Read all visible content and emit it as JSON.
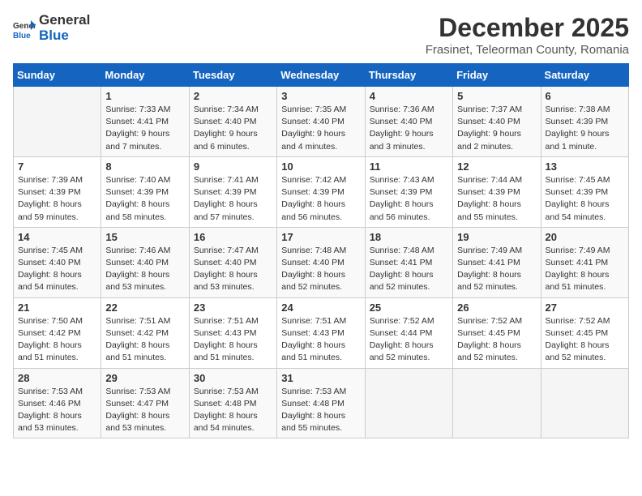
{
  "logo": {
    "text_general": "General",
    "text_blue": "Blue"
  },
  "title": {
    "month_year": "December 2025",
    "location": "Frasinet, Teleorman County, Romania"
  },
  "weekdays": [
    "Sunday",
    "Monday",
    "Tuesday",
    "Wednesday",
    "Thursday",
    "Friday",
    "Saturday"
  ],
  "weeks": [
    [
      {
        "day": "",
        "sunrise": "",
        "sunset": "",
        "daylight": ""
      },
      {
        "day": "1",
        "sunrise": "Sunrise: 7:33 AM",
        "sunset": "Sunset: 4:41 PM",
        "daylight": "Daylight: 9 hours and 7 minutes."
      },
      {
        "day": "2",
        "sunrise": "Sunrise: 7:34 AM",
        "sunset": "Sunset: 4:40 PM",
        "daylight": "Daylight: 9 hours and 6 minutes."
      },
      {
        "day": "3",
        "sunrise": "Sunrise: 7:35 AM",
        "sunset": "Sunset: 4:40 PM",
        "daylight": "Daylight: 9 hours and 4 minutes."
      },
      {
        "day": "4",
        "sunrise": "Sunrise: 7:36 AM",
        "sunset": "Sunset: 4:40 PM",
        "daylight": "Daylight: 9 hours and 3 minutes."
      },
      {
        "day": "5",
        "sunrise": "Sunrise: 7:37 AM",
        "sunset": "Sunset: 4:40 PM",
        "daylight": "Daylight: 9 hours and 2 minutes."
      },
      {
        "day": "6",
        "sunrise": "Sunrise: 7:38 AM",
        "sunset": "Sunset: 4:39 PM",
        "daylight": "Daylight: 9 hours and 1 minute."
      }
    ],
    [
      {
        "day": "7",
        "sunrise": "Sunrise: 7:39 AM",
        "sunset": "Sunset: 4:39 PM",
        "daylight": "Daylight: 8 hours and 59 minutes."
      },
      {
        "day": "8",
        "sunrise": "Sunrise: 7:40 AM",
        "sunset": "Sunset: 4:39 PM",
        "daylight": "Daylight: 8 hours and 58 minutes."
      },
      {
        "day": "9",
        "sunrise": "Sunrise: 7:41 AM",
        "sunset": "Sunset: 4:39 PM",
        "daylight": "Daylight: 8 hours and 57 minutes."
      },
      {
        "day": "10",
        "sunrise": "Sunrise: 7:42 AM",
        "sunset": "Sunset: 4:39 PM",
        "daylight": "Daylight: 8 hours and 56 minutes."
      },
      {
        "day": "11",
        "sunrise": "Sunrise: 7:43 AM",
        "sunset": "Sunset: 4:39 PM",
        "daylight": "Daylight: 8 hours and 56 minutes."
      },
      {
        "day": "12",
        "sunrise": "Sunrise: 7:44 AM",
        "sunset": "Sunset: 4:39 PM",
        "daylight": "Daylight: 8 hours and 55 minutes."
      },
      {
        "day": "13",
        "sunrise": "Sunrise: 7:45 AM",
        "sunset": "Sunset: 4:39 PM",
        "daylight": "Daylight: 8 hours and 54 minutes."
      }
    ],
    [
      {
        "day": "14",
        "sunrise": "Sunrise: 7:45 AM",
        "sunset": "Sunset: 4:40 PM",
        "daylight": "Daylight: 8 hours and 54 minutes."
      },
      {
        "day": "15",
        "sunrise": "Sunrise: 7:46 AM",
        "sunset": "Sunset: 4:40 PM",
        "daylight": "Daylight: 8 hours and 53 minutes."
      },
      {
        "day": "16",
        "sunrise": "Sunrise: 7:47 AM",
        "sunset": "Sunset: 4:40 PM",
        "daylight": "Daylight: 8 hours and 53 minutes."
      },
      {
        "day": "17",
        "sunrise": "Sunrise: 7:48 AM",
        "sunset": "Sunset: 4:40 PM",
        "daylight": "Daylight: 8 hours and 52 minutes."
      },
      {
        "day": "18",
        "sunrise": "Sunrise: 7:48 AM",
        "sunset": "Sunset: 4:41 PM",
        "daylight": "Daylight: 8 hours and 52 minutes."
      },
      {
        "day": "19",
        "sunrise": "Sunrise: 7:49 AM",
        "sunset": "Sunset: 4:41 PM",
        "daylight": "Daylight: 8 hours and 52 minutes."
      },
      {
        "day": "20",
        "sunrise": "Sunrise: 7:49 AM",
        "sunset": "Sunset: 4:41 PM",
        "daylight": "Daylight: 8 hours and 51 minutes."
      }
    ],
    [
      {
        "day": "21",
        "sunrise": "Sunrise: 7:50 AM",
        "sunset": "Sunset: 4:42 PM",
        "daylight": "Daylight: 8 hours and 51 minutes."
      },
      {
        "day": "22",
        "sunrise": "Sunrise: 7:51 AM",
        "sunset": "Sunset: 4:42 PM",
        "daylight": "Daylight: 8 hours and 51 minutes."
      },
      {
        "day": "23",
        "sunrise": "Sunrise: 7:51 AM",
        "sunset": "Sunset: 4:43 PM",
        "daylight": "Daylight: 8 hours and 51 minutes."
      },
      {
        "day": "24",
        "sunrise": "Sunrise: 7:51 AM",
        "sunset": "Sunset: 4:43 PM",
        "daylight": "Daylight: 8 hours and 51 minutes."
      },
      {
        "day": "25",
        "sunrise": "Sunrise: 7:52 AM",
        "sunset": "Sunset: 4:44 PM",
        "daylight": "Daylight: 8 hours and 52 minutes."
      },
      {
        "day": "26",
        "sunrise": "Sunrise: 7:52 AM",
        "sunset": "Sunset: 4:45 PM",
        "daylight": "Daylight: 8 hours and 52 minutes."
      },
      {
        "day": "27",
        "sunrise": "Sunrise: 7:52 AM",
        "sunset": "Sunset: 4:45 PM",
        "daylight": "Daylight: 8 hours and 52 minutes."
      }
    ],
    [
      {
        "day": "28",
        "sunrise": "Sunrise: 7:53 AM",
        "sunset": "Sunset: 4:46 PM",
        "daylight": "Daylight: 8 hours and 53 minutes."
      },
      {
        "day": "29",
        "sunrise": "Sunrise: 7:53 AM",
        "sunset": "Sunset: 4:47 PM",
        "daylight": "Daylight: 8 hours and 53 minutes."
      },
      {
        "day": "30",
        "sunrise": "Sunrise: 7:53 AM",
        "sunset": "Sunset: 4:48 PM",
        "daylight": "Daylight: 8 hours and 54 minutes."
      },
      {
        "day": "31",
        "sunrise": "Sunrise: 7:53 AM",
        "sunset": "Sunset: 4:48 PM",
        "daylight": "Daylight: 8 hours and 55 minutes."
      },
      {
        "day": "",
        "sunrise": "",
        "sunset": "",
        "daylight": ""
      },
      {
        "day": "",
        "sunrise": "",
        "sunset": "",
        "daylight": ""
      },
      {
        "day": "",
        "sunrise": "",
        "sunset": "",
        "daylight": ""
      }
    ]
  ]
}
